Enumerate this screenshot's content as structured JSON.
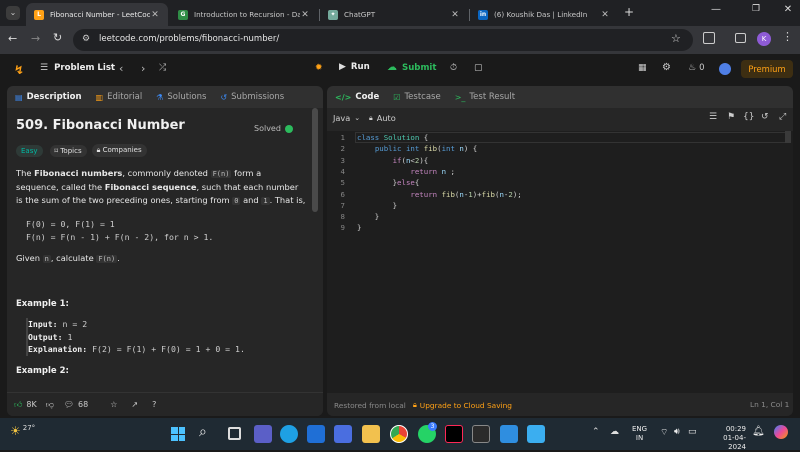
{
  "browser": {
    "tabs": [
      {
        "title": "Fibonacci Number - LeetCode",
        "active": true
      },
      {
        "title": "Introduction to Recursion - Dat",
        "active": false
      },
      {
        "title": "ChatGPT",
        "active": false
      },
      {
        "title": "(6) Koushik Das | LinkedIn",
        "active": false
      }
    ],
    "url": "leetcode.com/problems/fibonacci-number/",
    "profile_initial": "K"
  },
  "lc_header": {
    "problem_list_label": "Problem List",
    "run_label": "Run",
    "submit_label": "Submit",
    "streak_count": "0",
    "premium_label": "Premium"
  },
  "left_tabs": [
    "Description",
    "Editorial",
    "Solutions",
    "Submissions"
  ],
  "problem": {
    "title": "509. Fibonacci Number",
    "status": "Solved",
    "difficulty": "Easy",
    "tags": [
      "Topics",
      "Companies"
    ],
    "desc": {
      "p1_a": "The ",
      "p1_b": "Fibonacci numbers",
      "p1_c": ", commonly denoted ",
      "p1_code": "F(n)",
      "p1_d": " form a sequence, called the ",
      "p1_e": "Fibonacci sequence",
      "p1_f": ", such that each number is the sum of the two preceding ones, starting from ",
      "p1_0": "0",
      "p1_and": " and ",
      "p1_1": "1",
      "p1_end": ". That is,",
      "formula1": "F(0) = 0, F(1) = 1",
      "formula2": "F(n) = F(n - 1) + F(n - 2), for n > 1.",
      "given_a": "Given ",
      "given_n": "n",
      "given_b": ", calculate ",
      "given_code": "F(n)",
      "given_end": "."
    },
    "example1_heading": "Example 1:",
    "example1": {
      "input_label": "Input:",
      "input_value": " n = 2",
      "output_label": "Output:",
      "output_value": " 1",
      "expl_label": "Explanation:",
      "expl_value": " F(2) = F(1) + F(0) = 1 + 0 = 1."
    },
    "example2_heading": "Example 2:",
    "footer": {
      "likes": "8K",
      "comments": "68"
    }
  },
  "code_tabs": [
    "Code",
    "Testcase",
    "Test Result"
  ],
  "editor": {
    "language": "Java",
    "mode": "Auto",
    "line_numbers": [
      "1",
      "2",
      "3",
      "4",
      "5",
      "6",
      "7",
      "8",
      "9"
    ],
    "footer_left": "Restored from local",
    "footer_link": "Upgrade to Cloud Saving",
    "cursor_pos": "Ln 1, Col 1"
  },
  "taskbar": {
    "weather": "27°",
    "lang": "ENG",
    "region": "IN",
    "time": "00:29",
    "date": "01-04-2024",
    "badge_count": "3"
  },
  "colors": {
    "accent_orange": "#ffa116",
    "easy_teal": "#00b8a3",
    "solved_green": "#2cbb5d",
    "submit_green": "#2cbb5d",
    "premium_text": "#ffa116"
  }
}
